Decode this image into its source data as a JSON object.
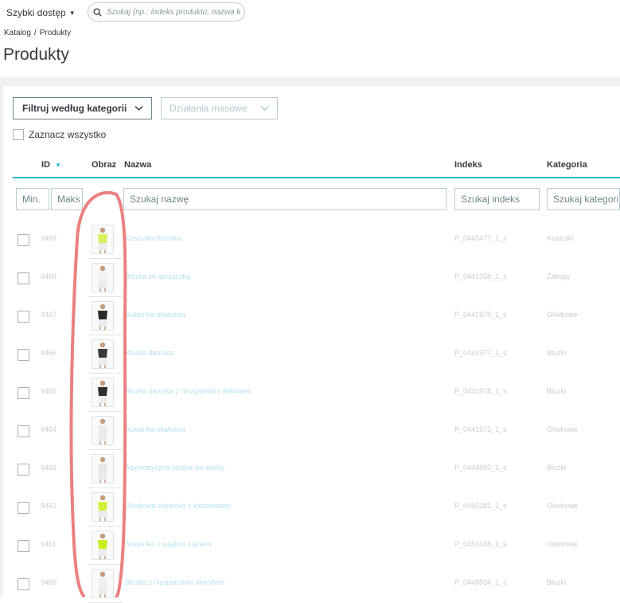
{
  "header": {
    "quick_access_label": "Szybki dostęp",
    "search_placeholder": "Szukaj (np.: indeks produktu, nazwa klie"
  },
  "breadcrumb": {
    "items": [
      "Katalog",
      "Produkty"
    ],
    "separator": "/"
  },
  "page": {
    "title": "Produkty"
  },
  "toolbar": {
    "filter_category_label": "Filtruj według kategorii",
    "bulk_actions_label": "Działania masowe",
    "select_all_label": "Zaznacz wszystko"
  },
  "table": {
    "columns": {
      "id": "ID",
      "image": "Obraz",
      "name": "Nazwa",
      "reference": "Indeks",
      "category": "Kategoria"
    },
    "filters": {
      "id_min_placeholder": "Min.",
      "id_max_placeholder": "Maks",
      "name_placeholder": "Szukaj nazwę",
      "reference_placeholder": "Szukaj indeks",
      "category_placeholder": "Szukaj kategorii"
    },
    "rows": [
      {
        "id": "9469",
        "name": "Koszulka damska",
        "reference": "P_0441477_1_s",
        "category": "Koszulki",
        "thumb_color": "#d8ef5a"
      },
      {
        "id": "9468",
        "name": "Bluzka ze sprzączką",
        "reference": "P_0441358_1_s",
        "category": "Zakupy",
        "thumb_color": "#f3f3f3"
      },
      {
        "id": "9467",
        "name": "Sukienka oliwkowa",
        "reference": "P_0441975_1_s",
        "category": "Oliwkowe",
        "thumb_color": "#2b2b2b"
      },
      {
        "id": "9466",
        "name": "Bluzka damska",
        "reference": "P_0441977_1_s",
        "category": "Bluzki",
        "thumb_color": "#3a3a3a"
      },
      {
        "id": "9465",
        "name": "Bluzka damska z hiszpańskim dekoltem",
        "reference": "P_0441978_1_s",
        "category": "Bluzki",
        "thumb_color": "#2f2f2f"
      },
      {
        "id": "9464",
        "name": "Sukienka oliwkowa",
        "reference": "P_0441973_1_s",
        "category": "Oliwkowe",
        "thumb_color": "#ebebeb"
      },
      {
        "id": "9463",
        "name": "Asymetryczna bluzka we wzory",
        "reference": "P_0444893_1_s",
        "category": "Bluzki",
        "thumb_color": "#e8e8e8"
      },
      {
        "id": "9462",
        "name": "Oliwkowa sukienka z kieszeniami",
        "reference": "P_0450281_1_s",
        "category": "Oliwkowe",
        "thumb_color": "#d4f03a"
      },
      {
        "id": "9461",
        "name": "Sukienka z wąskim stanem",
        "reference": "P_0450148_1_s",
        "category": "Oliwkowe",
        "thumb_color": "#c8f020"
      },
      {
        "id": "9460",
        "name": "Bluzka z hiszpańskim dekoltem",
        "reference": "P_0448834_1_s",
        "category": "Bluzki",
        "thumb_color": "#f0f0f0"
      }
    ]
  },
  "colors": {
    "accent": "#25b9d7",
    "annotation": "#e86a6a"
  }
}
